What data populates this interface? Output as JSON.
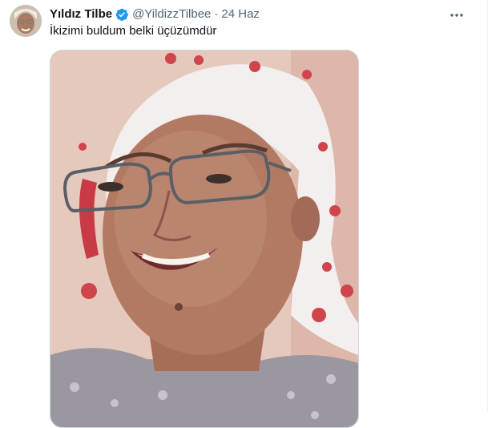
{
  "tweet": {
    "display_name": "Yıldız Tilbe",
    "handle": "@YildizzTilbee",
    "separator": "·",
    "date": "24 Haz",
    "text": "İkizimi buldum belki üçüzümdür",
    "verified": true
  },
  "icons": {
    "verified": "verified-badge-icon",
    "more": "more-horizontal-icon"
  },
  "colors": {
    "verified_blue": "#1d9bf0",
    "secondary_text": "#536471",
    "primary_text": "#0f1419"
  }
}
